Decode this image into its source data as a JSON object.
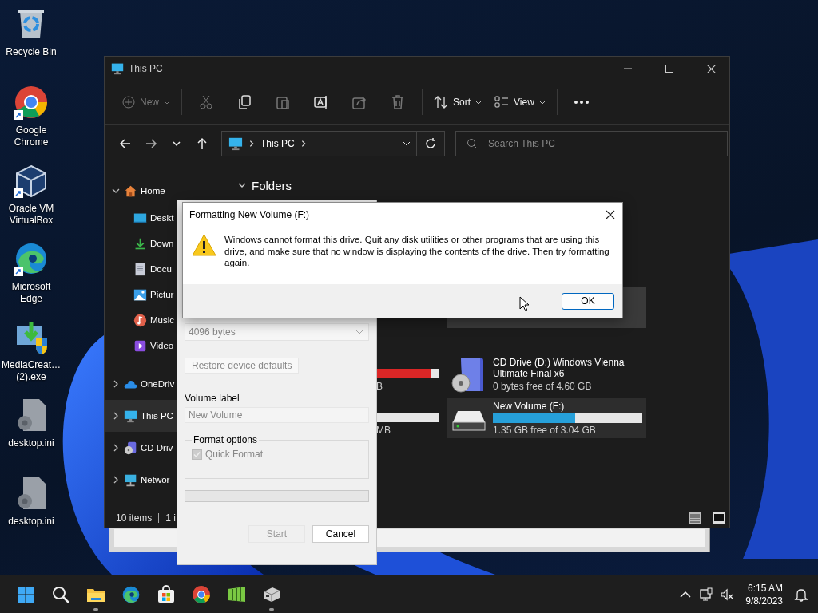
{
  "desktop_icons": [
    {
      "label": "Recycle Bin",
      "kind": "recycle_bin",
      "shortcut": false
    },
    {
      "label": "Google Chrome",
      "kind": "chrome",
      "shortcut": true
    },
    {
      "label": "Oracle VM VirtualBox",
      "kind": "virtualbox",
      "shortcut": true
    },
    {
      "label": "Microsoft Edge",
      "kind": "edge",
      "shortcut": true
    },
    {
      "label": "MediaCreat… (2).exe",
      "kind": "installer",
      "shortcut": false
    },
    {
      "label": "desktop.ini",
      "kind": "settings_file",
      "shortcut": false
    },
    {
      "label": "desktop.ini",
      "kind": "settings_file",
      "shortcut": false
    }
  ],
  "explorer": {
    "title": "This PC",
    "new": {
      "label": "New",
      "disabled": true
    },
    "tools": [
      {
        "kind": "cut",
        "disabled": true
      },
      {
        "kind": "copy",
        "disabled": false
      },
      {
        "kind": "paste",
        "disabled": true
      },
      {
        "kind": "rename",
        "disabled": false
      },
      {
        "kind": "share",
        "disabled": true
      },
      {
        "kind": "delete",
        "disabled": true
      }
    ],
    "sort": "Sort",
    "view": "View",
    "address": "This PC",
    "search_placeholder": "Search This PC",
    "sidebar": [
      {
        "label": "Home",
        "kind": "home",
        "expanded": true,
        "selected": false,
        "children": [
          {
            "label": "Deskt",
            "kind": "desktop",
            "selected": false
          },
          {
            "label": "Down",
            "kind": "downloads",
            "selected": false
          },
          {
            "label": "Docu",
            "kind": "documents",
            "selected": false
          },
          {
            "label": "Pictur",
            "kind": "pictures",
            "selected": false
          },
          {
            "label": "Music",
            "kind": "music",
            "selected": false
          },
          {
            "label": "Video",
            "kind": "videos",
            "selected": false
          }
        ]
      },
      {
        "label": "OneDriv",
        "kind": "cloud",
        "expanded": false,
        "selected": false
      },
      {
        "label": "This PC",
        "kind": "pc",
        "expanded": false,
        "selected": true
      },
      {
        "label": "CD Driv",
        "kind": "cd",
        "expanded": false,
        "selected": false
      },
      {
        "label": "Networ",
        "kind": "network",
        "expanded": false,
        "selected": false
      }
    ],
    "section": {
      "title": "Folders",
      "expanded": true
    },
    "drives": [
      {
        "kind": "covered",
        "highlighted": true
      },
      {
        "kind": "partial",
        "low_space": true,
        "level": 0.87,
        "free_text": "B"
      },
      {
        "kind": "cd",
        "name": "CD Drive (D:) Windows Vienna Ultimate Final x6",
        "free_text": "0 bytes free of 4.60 GB",
        "selected": false
      },
      {
        "kind": "partial",
        "level": 0,
        "free_text": "MB"
      },
      {
        "kind": "volume",
        "name": "New Volume (F:)",
        "level": 0.55,
        "free_text": "1.35 GB free of 3.04 GB",
        "selected": true
      }
    ],
    "status": {
      "count": "10 items",
      "selection": "1 i"
    }
  },
  "format_dialog": {
    "allocation": {
      "value": "4096 bytes",
      "disabled": true
    },
    "restore": {
      "label": "Restore device defaults",
      "disabled": true
    },
    "volume_label_caption": "Volume label",
    "volume_label": {
      "value": "New Volume",
      "disabled": true
    },
    "options_title": "Format options",
    "quick_format": {
      "label": "Quick Format",
      "checked": true,
      "disabled": true
    },
    "progress": {
      "level": 0
    },
    "start": {
      "label": "Start",
      "disabled": true
    },
    "cancel": {
      "label": "Cancel",
      "disabled": false
    }
  },
  "message_box": {
    "title": "Formatting New Volume (F:)",
    "message": "Windows cannot format this drive. Quit any disk utilities or other programs that are using this drive, and make sure that no window is displaying the contents of the drive. Then try formatting again.",
    "ok": "OK"
  },
  "taskbar": {
    "apps": [
      {
        "kind": "start",
        "running": false
      },
      {
        "kind": "search",
        "running": false
      },
      {
        "kind": "explorer",
        "running": true
      },
      {
        "kind": "edge",
        "running": false
      },
      {
        "kind": "store",
        "running": false
      },
      {
        "kind": "chrome",
        "running": false
      },
      {
        "kind": "tiles_app",
        "running": false
      },
      {
        "kind": "vm_app",
        "running": true
      }
    ],
    "time": "6:15 AM",
    "date": "9/8/2023"
  }
}
